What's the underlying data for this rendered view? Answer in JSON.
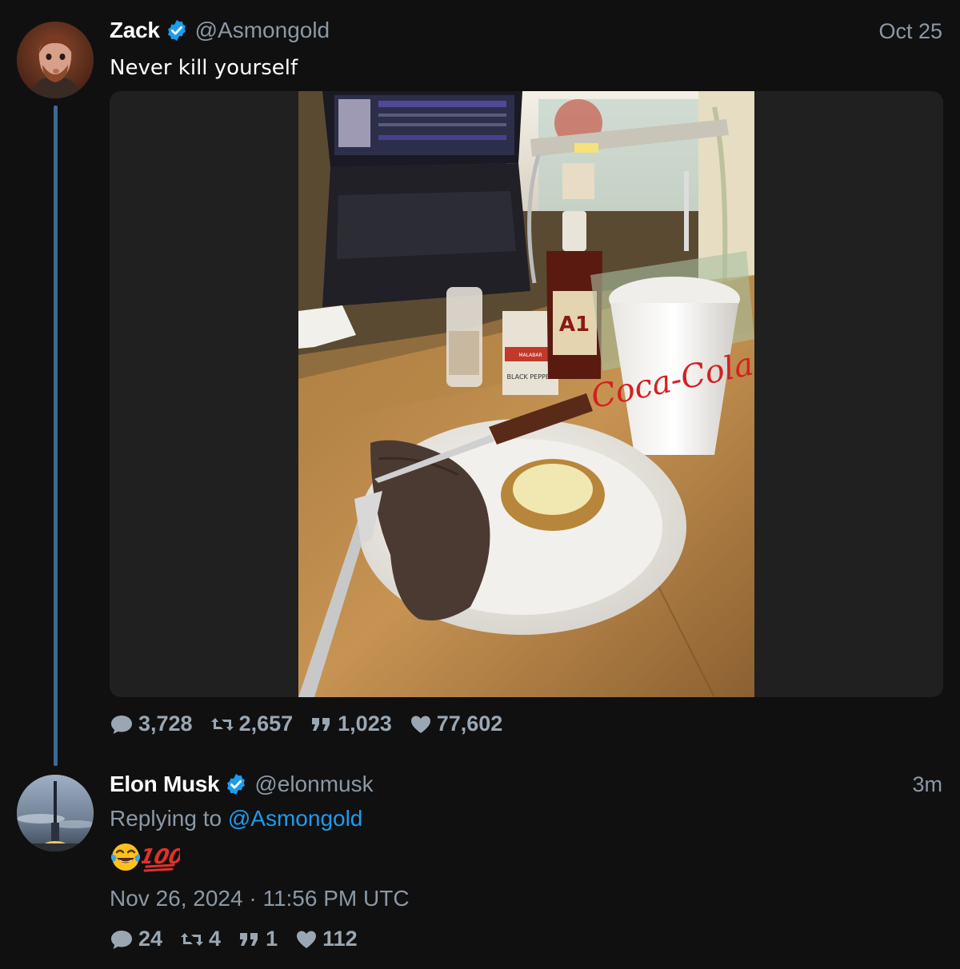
{
  "colors": {
    "background": "#101010",
    "accent": "#1d9bf0",
    "muted": "#8b98a5",
    "thread_line": "#3c6a93"
  },
  "original_tweet": {
    "author": {
      "name": "Zack",
      "handle": "@Asmongold",
      "verified": true,
      "avatar_icon": "user-avatar-photo"
    },
    "time": "Oct 25",
    "text": "Never kill yourself",
    "media": {
      "type": "photo",
      "visible_text": [
        "BLACK PEPPER",
        "MALABAR",
        "A1",
        "Coca-Cola"
      ]
    },
    "stats": {
      "replies": "3,728",
      "retweets": "2,657",
      "quotes": "1,023",
      "likes": "77,602"
    }
  },
  "reply_tweet": {
    "author": {
      "name": "Elon Musk",
      "handle": "@elonmusk",
      "verified": true,
      "avatar_icon": "rocket-launch-photo"
    },
    "time": "3m",
    "replying_to_label": "Replying to",
    "replying_to_handle": "@Asmongold",
    "emojis": [
      "face-with-tears-of-joy",
      "hundred-points"
    ],
    "datetime": "Nov 26, 2024 · 11:56 PM UTC",
    "stats": {
      "replies": "24",
      "retweets": "4",
      "quotes": "1",
      "likes": "112"
    }
  }
}
